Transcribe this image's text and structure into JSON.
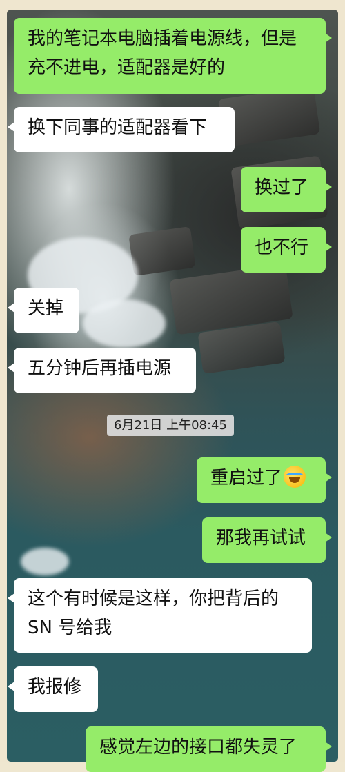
{
  "conversation": {
    "messages": [
      {
        "side": "me",
        "text": "我的笔记本电脑插着电源线，但是充不进电，适配器是好的"
      },
      {
        "side": "them",
        "text": "换下同事的适配器看下"
      },
      {
        "side": "me",
        "text": "换过了"
      },
      {
        "side": "me",
        "text": "也不行"
      },
      {
        "side": "them",
        "text": "关掉"
      },
      {
        "side": "them",
        "text": "五分钟后再插电源"
      },
      {
        "side": "me",
        "text": "重启过了",
        "emoji": "crying-laughing-emoji"
      },
      {
        "side": "me",
        "text": "那我再试试"
      },
      {
        "side": "them",
        "text": "这个有时候是这样，你把背后的SN 号给我"
      },
      {
        "side": "them",
        "text": "我报修"
      },
      {
        "side": "me",
        "text": "感觉左边的接口都失灵了"
      }
    ],
    "timestamp": "6月21日 上午08:45"
  },
  "colors": {
    "my_bubble": "#95ec69",
    "their_bubble": "#ffffff",
    "timestamp_bg": "#dcdcdc"
  }
}
